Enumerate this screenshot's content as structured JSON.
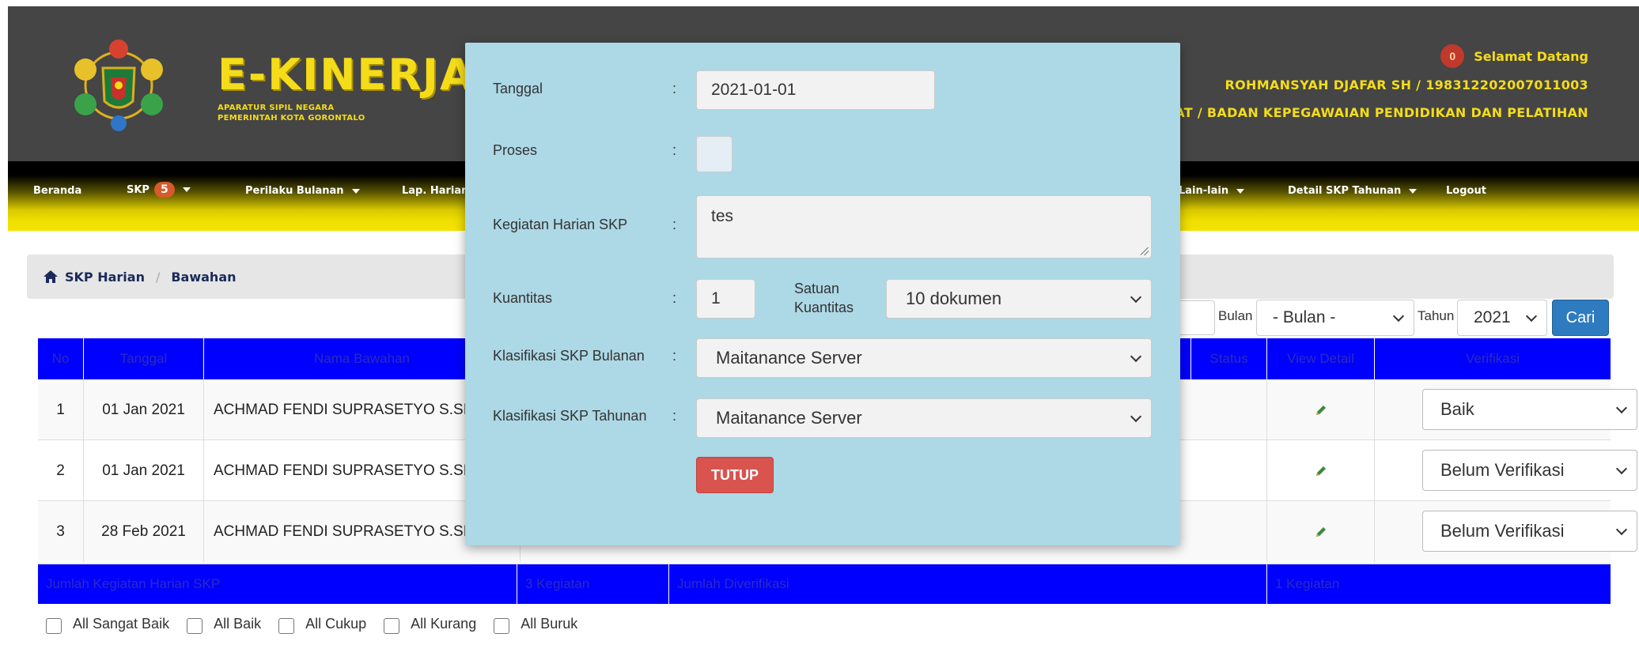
{
  "header": {
    "brand_title": "E-KINERJA",
    "brand_sub1": "APARATUR SIPIL NEGARA",
    "brand_sub2": "PEMERINTAH KOTA GORONTALO",
    "notif_count": "0",
    "welcome": "Selamat Datang",
    "user_name": "ROHMANSYAH DJAFAR SH / 198312202007011003",
    "user_unit": "LAT / BADAN KEPEGAWAIAN PENDIDIKAN DAN PELATIHAN"
  },
  "nav": {
    "beranda": "Beranda",
    "skp": "SKP",
    "skp_count": "5",
    "perilaku": "Perilaku Bulanan",
    "lap_harian": "Lap. Harian",
    "lain_lain": "Lain-lain",
    "detail_skp": "Detail SKP Tahunan",
    "logout": "Logout"
  },
  "breadcrumb": {
    "item1": "SKP Harian",
    "sep": "/",
    "item2": "Bawahan"
  },
  "filters": {
    "bulan_label": "Bulan",
    "bulan_value": "- Bulan -",
    "tahun_label": "Tahun",
    "tahun_value": "2021",
    "cari": "Cari"
  },
  "table": {
    "headers": {
      "no": "No",
      "tanggal": "Tanggal",
      "nama": "Nama Bawahan",
      "status": "Status",
      "view_detail": "View Detail",
      "verifikasi": "Verifikasi"
    },
    "rows": [
      {
        "no": "1",
        "tanggal": "01 Jan 2021",
        "nama": "ACHMAD FENDI SUPRASETYO S.SI",
        "verifikasi": "Baik"
      },
      {
        "no": "2",
        "tanggal": "01 Jan 2021",
        "nama": "ACHMAD FENDI SUPRASETYO S.SI",
        "verifikasi": "Belum Verifikasi"
      },
      {
        "no": "3",
        "tanggal": "28 Feb 2021",
        "nama": "ACHMAD FENDI SUPRASETYO S.SI",
        "verifikasi": "Belum Verifikasi"
      }
    ],
    "footer": {
      "jumlah_label": "Jumlah Kegiatan Harian SKP",
      "jumlah_value": "3 Kegiatan",
      "diverifikasi_label": "Jumlah Diverifikasi",
      "diverifikasi_value": "1 Kegiatan"
    }
  },
  "bulk_checks": [
    "All Sangat Baik",
    "All Baik",
    "All Cukup",
    "All Kurang",
    "All Buruk"
  ],
  "modal": {
    "tanggal_label": "Tanggal",
    "tanggal_value": "2021-01-01",
    "proses_label": "Proses",
    "kegiatan_label": "Kegiatan Harian SKP",
    "kegiatan_value": "tes",
    "kuantitas_label": "Kuantitas",
    "kuantitas_value": "1",
    "satuan_label_1": "Satuan",
    "satuan_label_2": "Kuantitas",
    "satuan_value": "10 dokumen",
    "klas_bulanan_label": "Klasifikasi SKP Bulanan",
    "klas_bulanan_value": "Maitanance Server",
    "klas_tahunan_label": "Klasifikasi SKP Tahunan",
    "klas_tahunan_value": "Maitanance Server",
    "colon": ":",
    "tutup": "TUTUP"
  },
  "colors": {
    "header_bg": "#454545",
    "brand_yellow": "#f4dc1a",
    "table_blue": "#0000ff",
    "modal_bg": "#add8e6",
    "danger": "#d9534f",
    "primary": "#2e7bbf"
  }
}
